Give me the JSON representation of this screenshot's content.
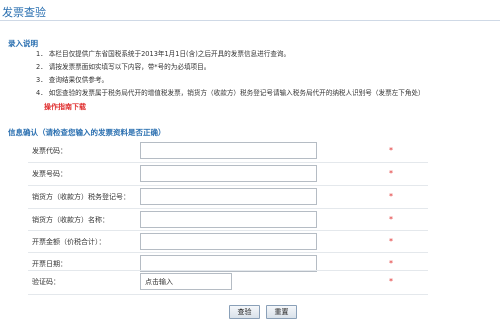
{
  "page": {
    "title": "发票查验"
  },
  "input_section": {
    "heading": "录入说明",
    "instructions": [
      {
        "num": "1．",
        "text": "本栏目仅提供广东省国税系统于2013年1月1日(含)之后开具的发票信息进行查询。"
      },
      {
        "num": "2．",
        "text": "请按发票票面如实填写以下内容，带*号的为必填项目。"
      },
      {
        "num": "3．",
        "text": "查询结果仅供参考。"
      },
      {
        "num": "4．",
        "text": "如您查验的发票属于税务局代开的增值税发票，销货方（收款方）税务登记号请输入税务局代开的纳税人识别号（发票左下角处）"
      }
    ],
    "guide_link": "操作指南下载"
  },
  "confirm_section": {
    "heading": "信息确认（请检查您输入的发票资料是否正确）",
    "fields": [
      {
        "label": "发票代码：",
        "value": "",
        "required": "*"
      },
      {
        "label": "发票号码：",
        "value": "",
        "required": "*"
      },
      {
        "label": "销货方（收款方）税务登记号：",
        "value": "",
        "required": "*"
      },
      {
        "label": "销货方（收款方）名称：",
        "value": "",
        "required": "*"
      },
      {
        "label": "开票金额（价税合计）：",
        "value": "",
        "required": "*"
      },
      {
        "label": "开票日期：",
        "value": "",
        "required": "*"
      },
      {
        "label": "验证码：",
        "value": "点击输入",
        "required": "*"
      }
    ]
  },
  "buttons": {
    "query": "查验",
    "reset": "重置"
  }
}
